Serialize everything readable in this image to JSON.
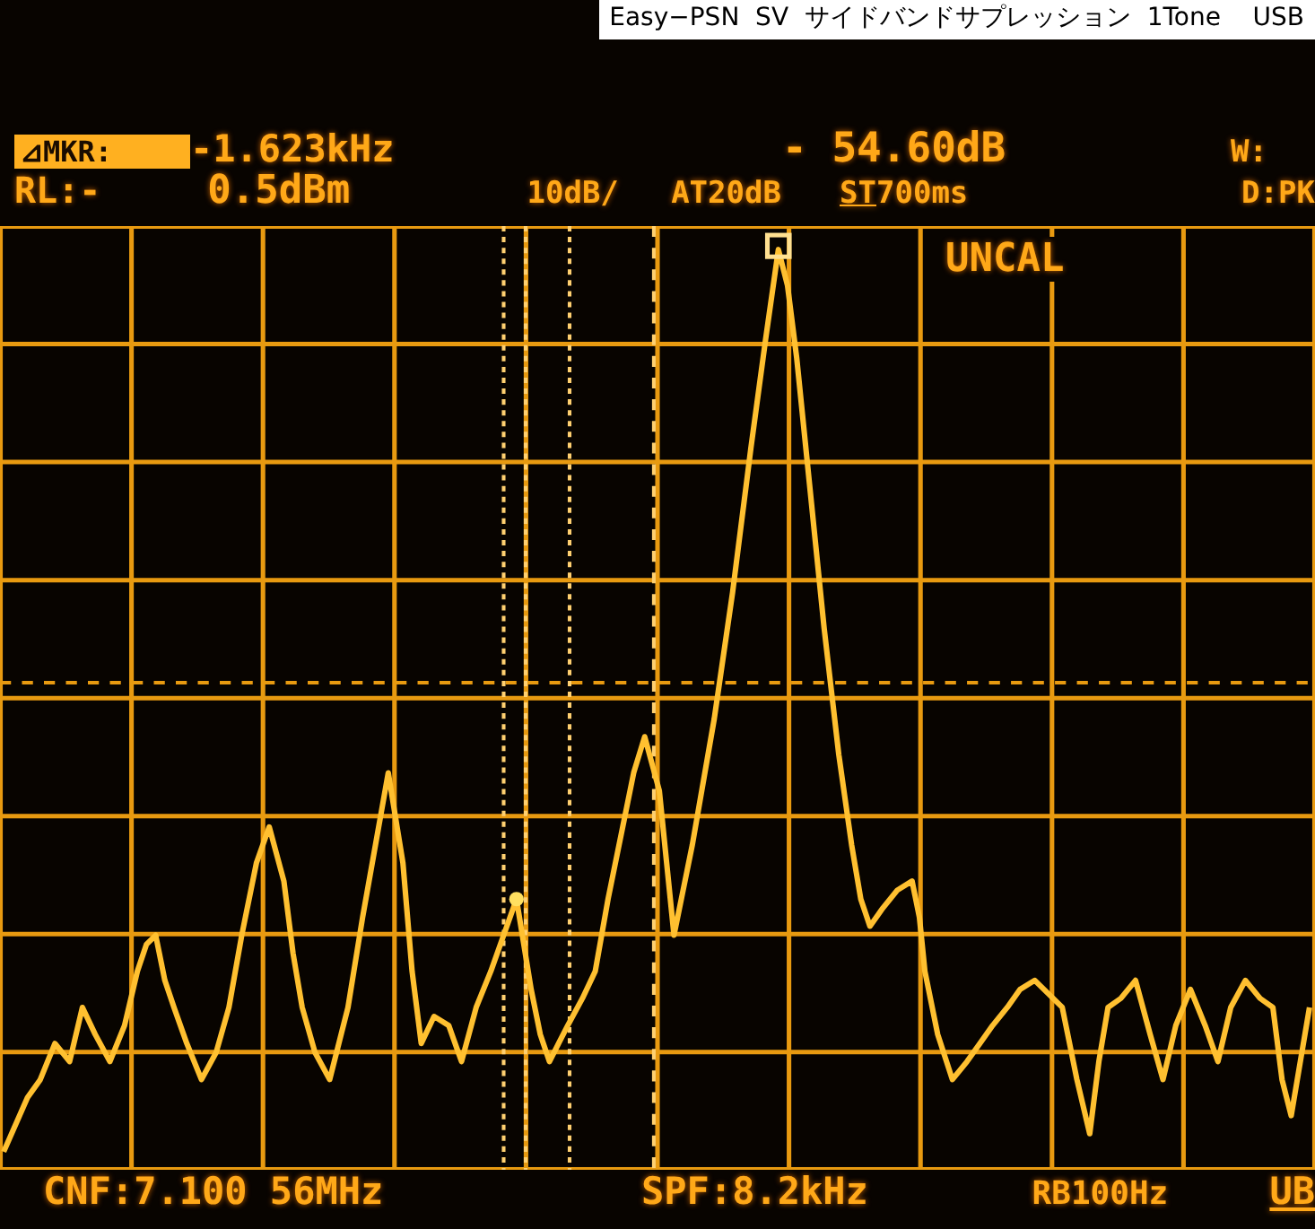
{
  "caption": "Easy−PSN  SV  サイドバンドサプレッション  1Tone    USB",
  "readout": {
    "marker_label": "⊿MKR:",
    "marker_freq": "-1.623kHz",
    "marker_level": "- 54.60dB",
    "window": "W:",
    "ref_label": "RL:-",
    "ref_level": "0.5dBm",
    "scale": "10dB/",
    "attenuation": "AT20dB",
    "sweep_label": "ST",
    "sweep_time": "700ms",
    "detector": "D:PK"
  },
  "graph": {
    "status": "UNCAL"
  },
  "footer": {
    "center_freq": "CNF:7.100 56MHz",
    "span": "SPF:8.2kHz",
    "rbw": "RB100Hz",
    "mode": "UB"
  }
}
